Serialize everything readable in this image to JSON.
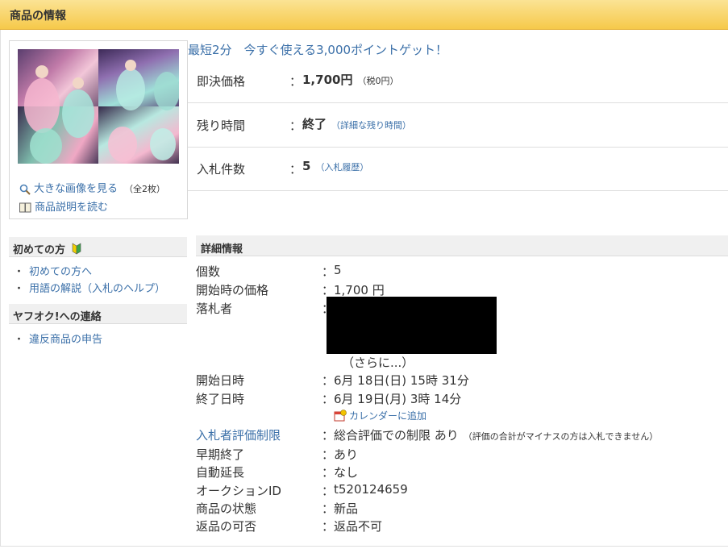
{
  "header": {
    "title": "商品の情報"
  },
  "image_panel": {
    "view_large_label": "大きな画像を見る",
    "image_count": "（全2枚）",
    "read_description_label": "商品説明を読む"
  },
  "promo": {
    "text": "最短2分　今すぐ使える3,000ポイントゲット！"
  },
  "summary": [
    {
      "label": "即決価格",
      "value": "1,700円",
      "sub": "（税0円）",
      "sub_link": false
    },
    {
      "label": "残り時間",
      "value": "終了",
      "sub": "（詳細な残り時間）",
      "sub_link": true
    },
    {
      "label": "入札件数",
      "value": "5",
      "sub": "（入札履歴）",
      "sub_link": true
    }
  ],
  "sidebar": {
    "beginners_title": "初めての方",
    "beginners_items": [
      "初めての方へ",
      "用語の解説（入札のヘルプ）"
    ],
    "contact_title": "ヤフオク!への連絡",
    "contact_items": [
      "違反商品の申告"
    ]
  },
  "details": {
    "title": "詳細情報",
    "quantity_label": "個数",
    "quantity": "5",
    "start_price_label": "開始時の価格",
    "start_price": "1,700 円",
    "winner_label": "落札者",
    "winner_more": "（さらに...）",
    "start_date_label": "開始日時",
    "start_date": "6月 18日(日) 15時 31分",
    "end_date_label": "終了日時",
    "end_date": "6月 19日(月) 3時 14分",
    "calendar_label": "カレンダーに追加",
    "bidder_limit_label": "入札者評価制限",
    "bidder_limit": "総合評価での制限 あり",
    "bidder_limit_note": "（評価の合計がマイナスの方は入札できません）",
    "early_end_label": "早期終了",
    "early_end": "あり",
    "auto_extend_label": "自動延長",
    "auto_extend": "なし",
    "auction_id_label": "オークションID",
    "auction_id": "t520124659",
    "condition_label": "商品の状態",
    "condition": "新品",
    "returns_label": "返品の可否",
    "returns": "返品不可"
  },
  "colors": {
    "header_yellow": "#f6c94a",
    "link_blue": "#3a6fa8"
  }
}
